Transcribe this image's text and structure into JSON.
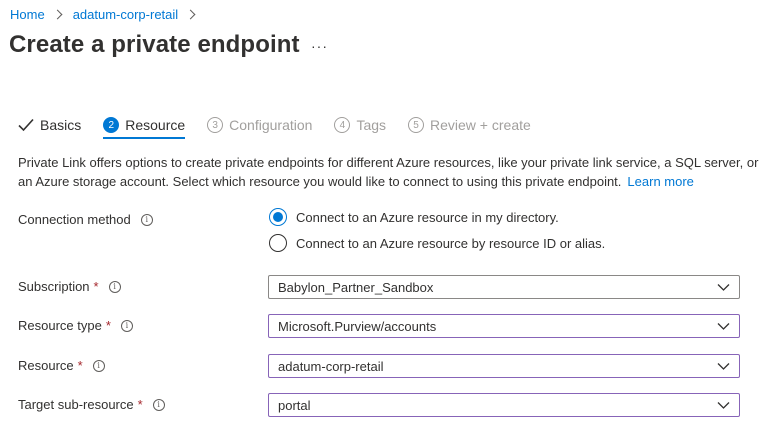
{
  "breadcrumb": {
    "home": "Home",
    "resource": "adatum-corp-retail"
  },
  "header": {
    "title": "Create a private endpoint",
    "more": "···"
  },
  "tabs": [
    {
      "label": "Basics",
      "state": "done"
    },
    {
      "number": "2",
      "label": "Resource",
      "state": "active"
    },
    {
      "number": "3",
      "label": "Configuration",
      "state": "disabled"
    },
    {
      "number": "4",
      "label": "Tags",
      "state": "disabled"
    },
    {
      "number": "5",
      "label": "Review + create",
      "state": "disabled"
    }
  ],
  "intro": {
    "text": "Private Link offers options to create private endpoints for different Azure resources, like your private link service, a SQL server, or an Azure storage account. Select which resource you would like to connect to using this private endpoint.",
    "learn_more": "Learn more"
  },
  "form": {
    "connection_method": {
      "label": "Connection method",
      "options": [
        {
          "label": "Connect to an Azure resource in my directory.",
          "checked": true
        },
        {
          "label": "Connect to an Azure resource by resource ID or alias.",
          "checked": false
        }
      ]
    },
    "subscription": {
      "label": "Subscription",
      "required": "*",
      "value": "Babylon_Partner_Sandbox"
    },
    "resource_type": {
      "label": "Resource type",
      "required": "*",
      "value": "Microsoft.Purview/accounts"
    },
    "resource": {
      "label": "Resource",
      "required": "*",
      "value": "adatum-corp-retail"
    },
    "target_sub_resource": {
      "label": "Target sub-resource",
      "required": "*",
      "value": "portal"
    }
  },
  "icons": {
    "info": "i",
    "accent": "#0078d4",
    "required_color": "#a4262c"
  }
}
